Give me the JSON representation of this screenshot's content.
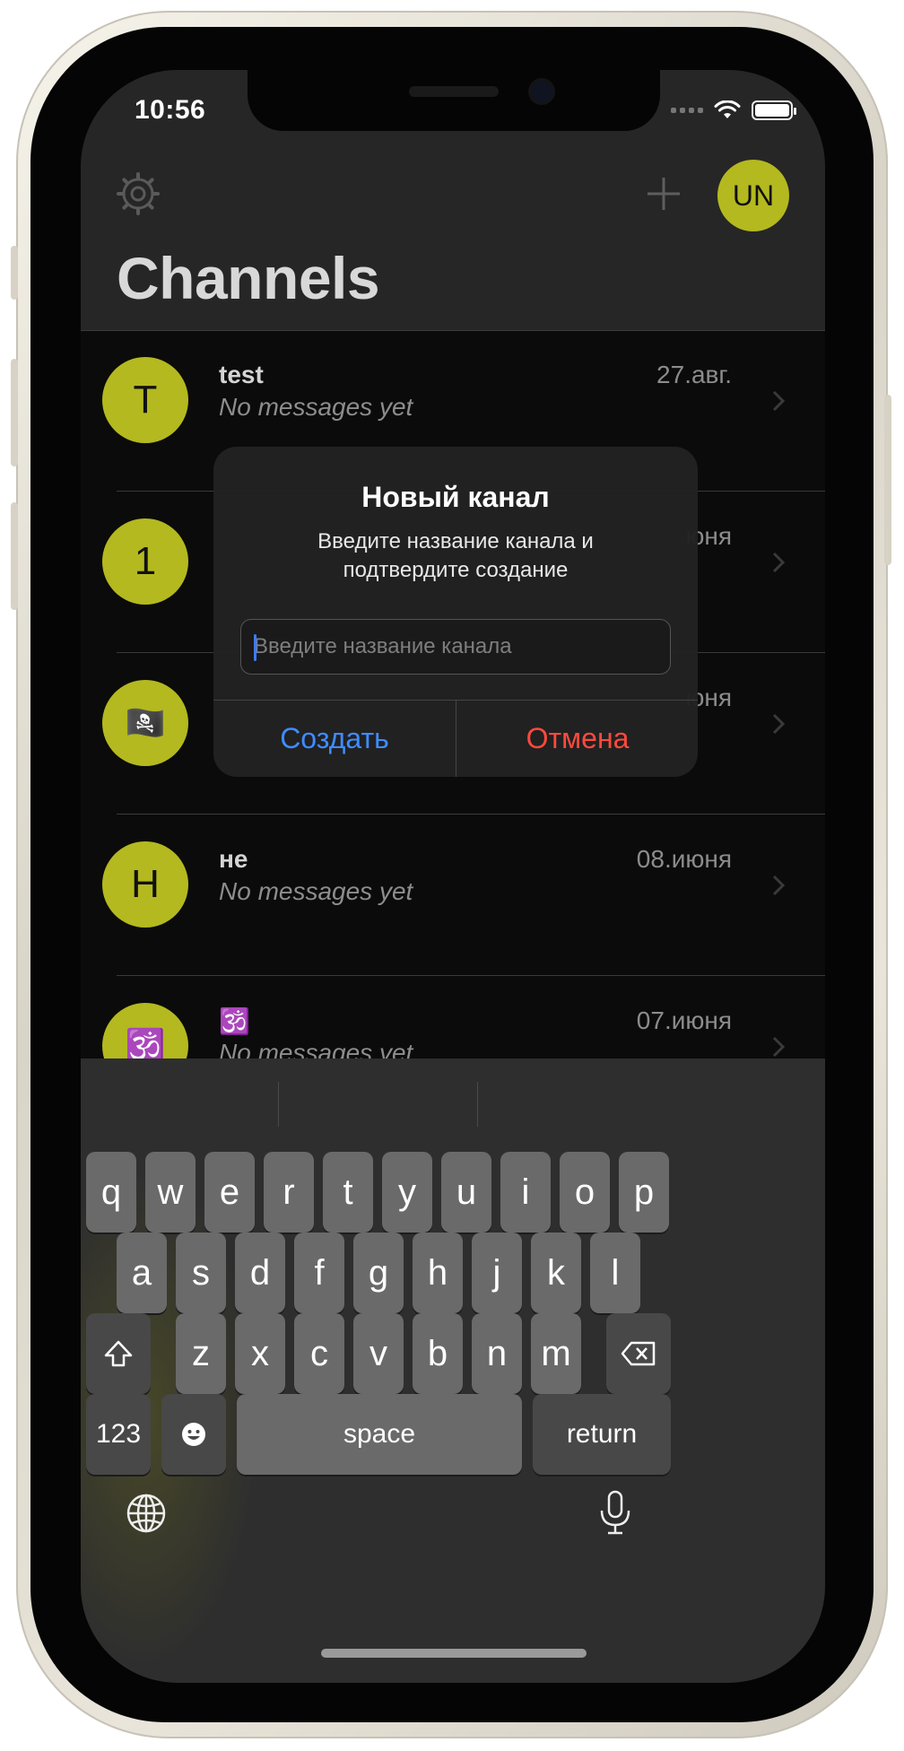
{
  "status": {
    "time": "10:56"
  },
  "header": {
    "title": "Channels",
    "user_initials": "UN"
  },
  "channels": [
    {
      "avatar": "T",
      "name": "test",
      "last_message": "No messages yet",
      "date": "27.авг."
    },
    {
      "avatar": "1",
      "name": "",
      "last_message": "",
      "date": "юня"
    },
    {
      "avatar": "🏴‍☠️",
      "name": "",
      "last_message": "",
      "date": "юня"
    },
    {
      "avatar": "Н",
      "name": "не",
      "last_message": "No messages yet",
      "date": "08.июня"
    },
    {
      "avatar": "🕉️",
      "name": "🕉️",
      "last_message": "No messages yet",
      "date": "07.июня"
    }
  ],
  "dialog": {
    "title": "Новый канал",
    "message_line1": "Введите название канала и",
    "message_line2": "подтвердите создание",
    "placeholder": "Введите название канала",
    "create_label": "Создать",
    "cancel_label": "Отмена"
  },
  "keyboard": {
    "row1": [
      "q",
      "w",
      "e",
      "r",
      "t",
      "y",
      "u",
      "i",
      "o",
      "p"
    ],
    "row2": [
      "a",
      "s",
      "d",
      "f",
      "g",
      "h",
      "j",
      "k",
      "l"
    ],
    "row3": [
      "z",
      "x",
      "c",
      "v",
      "b",
      "n",
      "m"
    ],
    "numbers_label": "123",
    "space_label": "space",
    "return_label": "return"
  }
}
